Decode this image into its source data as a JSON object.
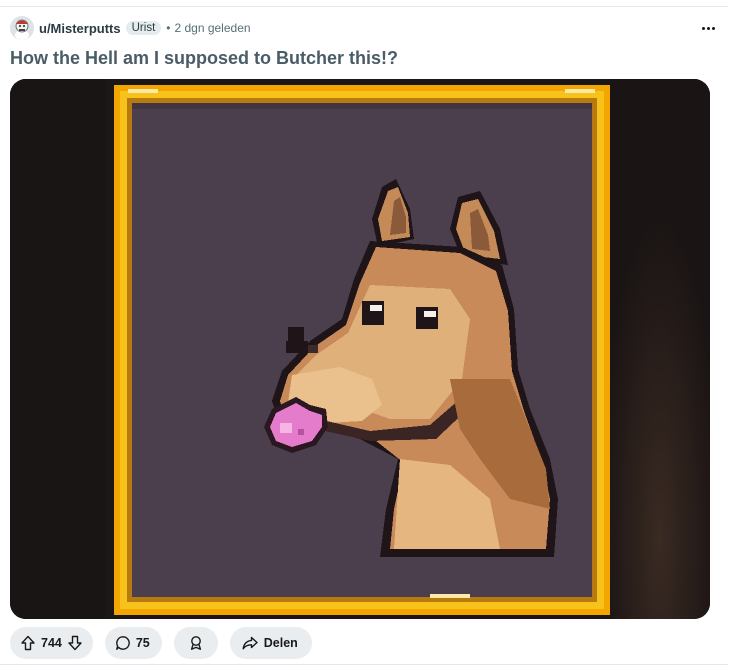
{
  "post": {
    "author": "u/Misterputts",
    "flair": "Urist",
    "separator": "•",
    "time": "2 dgn geleden",
    "title": "How the Hell am I supposed to Butcher this!?"
  },
  "actions": {
    "votes": "744",
    "comments": "75",
    "share_label": "Delen"
  },
  "icons": {
    "more": "more-horizontal-icon",
    "upvote": "arrow-up-icon",
    "downvote": "arrow-down-icon",
    "comment": "comment-bubble-icon",
    "award": "award-icon",
    "share": "share-arrow-icon"
  },
  "colors": {
    "frame": "#f0a800",
    "portrait_bg": "#4a3e4c",
    "tongue": "#e070c0"
  }
}
